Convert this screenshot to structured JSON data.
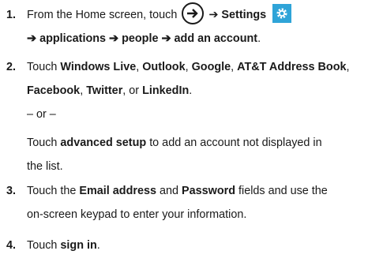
{
  "steps": [
    {
      "number": "1.",
      "line1_a": "From the Home screen, touch",
      "line1_arrow1": "➔",
      "line1_settings": "Settings",
      "line2_arrow": "➔",
      "line2_apps": "applications",
      "line2_arrow2": "➔",
      "line2_people": "people",
      "line2_arrow3": "➔",
      "line2_add": "add an account",
      "line2_end": "."
    },
    {
      "number": "2.",
      "touch": "Touch",
      "windows_live": "Windows Live",
      "outlook": "Outlook",
      "google": "Google",
      "att": "AT&T Address Book",
      "facebook": "Facebook",
      "twitter": "Twitter",
      "or": "or",
      "linkedin": "LinkedIn",
      "sep": ", ",
      "period": ".",
      "or_line": "– or –",
      "adv_touch": "Touch",
      "advanced_setup": "advanced setup",
      "adv_rest": "to add an account not displayed in",
      "adv_line2": "the list."
    },
    {
      "number": "3.",
      "touch_the": "Touch the",
      "email": "Email address",
      "and": "and",
      "password": "Password",
      "rest1": "fields and use the",
      "line2": "on-screen keypad to enter your information."
    },
    {
      "number": "4.",
      "touch": "Touch",
      "sign_in": "sign in",
      "period": "."
    }
  ],
  "icons": {
    "navigate": "circle-arrow-icon",
    "settings": "gear-icon",
    "settings_color": "#2fa4d8"
  }
}
